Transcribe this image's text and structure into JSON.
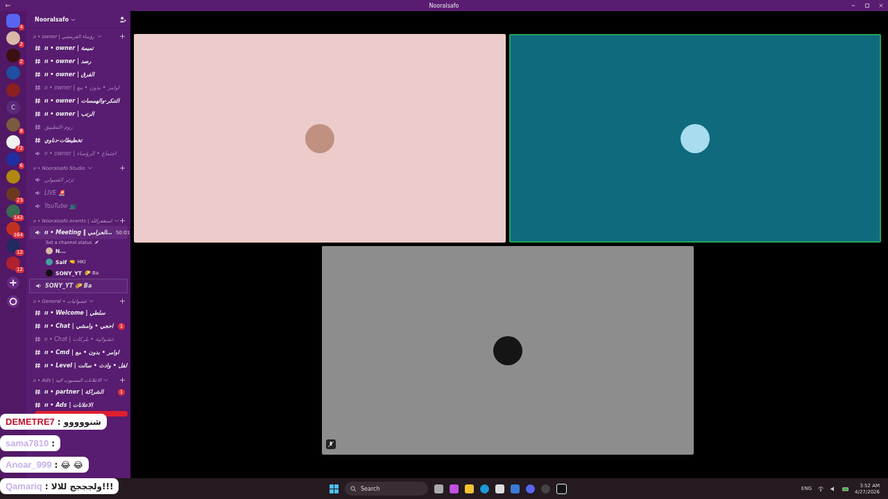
{
  "window": {
    "title": "Nooralsafo"
  },
  "servers": [
    {
      "color": "#5865f2",
      "badge": "4",
      "selected": true
    },
    {
      "color": "#d9b8a8",
      "badge": "2",
      "selected": false
    },
    {
      "color": "#3a1010",
      "badge": "2",
      "selected": false
    },
    {
      "color": "#1f4fa0",
      "selected": false
    },
    {
      "color": "#8a2020",
      "selected": false
    },
    {
      "color": "#5a2a78",
      "letter": "C",
      "selected": false
    },
    {
      "color": "#7a5a40",
      "badge": "8",
      "selected": false
    },
    {
      "color": "#f0f0f0",
      "badge": "72",
      "selected": false
    },
    {
      "color": "#2030a0",
      "badge": "6",
      "selected": false
    },
    {
      "color": "#b08a10",
      "selected": false
    },
    {
      "color": "#6a3a20",
      "badge": "23",
      "selected": false
    },
    {
      "color": "#3a6a50",
      "badge": "142",
      "selected": false
    },
    {
      "color": "#c03020",
      "badge": "164",
      "selected": false
    },
    {
      "color": "#202a60",
      "badge": "12",
      "selected": false
    },
    {
      "color": "#b02030",
      "badge": "12",
      "selected": false
    }
  ],
  "server_name": "Nooralsafo",
  "categories": [
    {
      "label": "ıı • owner | رؤساء القرمشي",
      "channels": [
        {
          "kind": "text",
          "name": "ıı • owner | تميمة",
          "muted": false
        },
        {
          "kind": "text",
          "name": "ıı • owner | رصد",
          "muted": false
        },
        {
          "kind": "text",
          "name": "ıı • owner | الفرق",
          "muted": false
        },
        {
          "kind": "text",
          "name": "ıı • owner | اوامر • بدون • مع",
          "muted": true
        },
        {
          "kind": "text",
          "name": "ıı • owner | التنكر-والهمسات",
          "muted": false
        },
        {
          "kind": "text",
          "name": "ıı • owner | الرتب",
          "muted": false
        },
        {
          "kind": "text",
          "name": "روم-التطبيق",
          "muted": true
        },
        {
          "kind": "text",
          "name": "تخطيطات-دناوي",
          "muted": false
        },
        {
          "kind": "voice",
          "name": "ıı • owner | اجتماع • الرؤساء",
          "muted": true
        }
      ]
    },
    {
      "label": "ıı • Nooralsafo Studio",
      "channels": [
        {
          "kind": "voice",
          "name": "تزتر القنبولي",
          "muted": true
        },
        {
          "kind": "voice",
          "name": "LIVE 🚨",
          "muted": true
        },
        {
          "kind": "voice",
          "name": "YouTube 📺",
          "muted": true
        }
      ]
    },
    {
      "label": "ıı • Nooralsafo events | استغفرالله",
      "channels": [
        {
          "kind": "voice",
          "name": "ıı • Meeting ‖ الحرامي…",
          "muted": false,
          "time": "50:01",
          "status": "Set a channel status",
          "users": [
            {
              "name": "N...",
              "color": "#d8b8a8"
            },
            {
              "name": "Saif",
              "tag": "🤜 HKI",
              "color": "#40a0a0"
            },
            {
              "name": "SONY_YT",
              "tag": "🌮 Ba",
              "color": "#111111"
            }
          ]
        },
        {
          "kind": "voice",
          "name": "SONY_YT 🌮 Ba",
          "muted": false,
          "dragging": true
        }
      ]
    },
    {
      "label": "ıı • General • عشوائيات",
      "channels": [
        {
          "kind": "text",
          "name": "ıı • Welcome | سلطي",
          "muted": false
        },
        {
          "kind": "text",
          "name": "ıı • Chat | احجي • وامشي",
          "muted": false,
          "badge": "1"
        },
        {
          "kind": "text",
          "name": "ıı • Chat | عشوائية • بلركات",
          "muted": true
        },
        {
          "kind": "text",
          "name": "ıı • Cmd | اوامر • بدون • مع",
          "muted": false
        },
        {
          "kind": "text",
          "name": "ıı • Level | لفل • وادث • سالت",
          "muted": false
        }
      ]
    },
    {
      "label": "ıı • Ads | الاعلانات المسيوب اليه",
      "channels": [
        {
          "kind": "text",
          "name": "ıı • partner | الشراكة",
          "muted": false,
          "badge": "1"
        },
        {
          "kind": "text",
          "name": "ıı • Ads | الاعلانات",
          "muted": false
        }
      ]
    }
  ],
  "chat_overlay": [
    {
      "user": "DEMETRE7",
      "text": ": شنووووو",
      "color": "#c0102a"
    },
    {
      "user": "sama7810",
      "text": ":",
      "color": "#c8b0e8"
    },
    {
      "user": "Anoar_999",
      "text": ": 😂 😂",
      "color": "#c8b0e8"
    },
    {
      "user": "Qamariq",
      "text": ": ولجججج للالا!!!",
      "color": "#c8b0e8"
    }
  ],
  "tiles": [
    {
      "color": "#ecccca",
      "speaking": false
    },
    {
      "color": "#0f6a7e",
      "speaking": true
    },
    {
      "color": "#8d8d8d",
      "speaking": false,
      "muted": true
    }
  ],
  "taskbar": {
    "search": "Search",
    "lang": "ENG",
    "time": "3:52 AM",
    "date": "4/27/2026"
  }
}
